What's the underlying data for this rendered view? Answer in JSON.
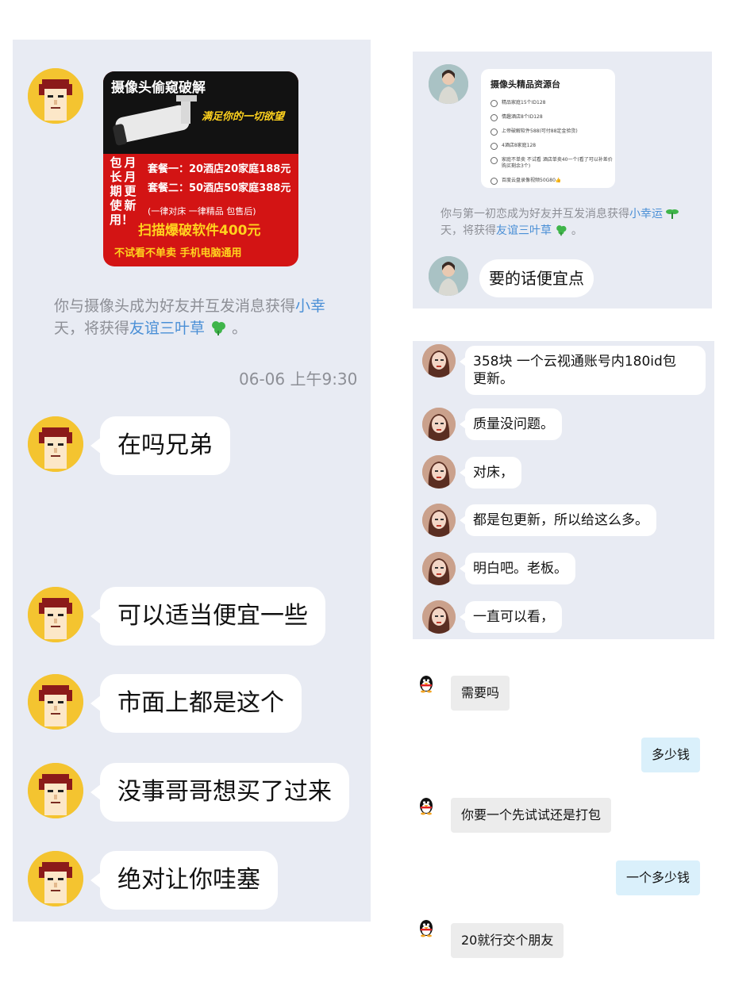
{
  "left_chat": {
    "ad": {
      "title": "摄像头偷窥破解",
      "slogan": "满足你的一切欲望",
      "vertical_col1": "包长期使用！",
      "vertical_col2": "月月更新",
      "package_1": "套餐一：20酒店20家庭188元",
      "package_2": "套餐二：50酒店50家庭388元",
      "note": "(一律对床 一律精品   包售后)",
      "software": "扫描爆破软件400元",
      "footer": "不试看不单卖 手机电脑通用"
    },
    "system_line1_prefix": "你与摄像头成为好友并互发消息获得",
    "system_line1_link": "小幸",
    "system_line2_prefix": "天，将获得",
    "system_line2_link": "友谊三叶草",
    "system_line2_suffix": "。",
    "timestamp": "06-06 上午9:30",
    "messages": [
      "在吗兄弟",
      "可以适当便宜一些",
      "市面上都是这个",
      "没事哥哥想买了过来",
      "绝对让你哇塞"
    ]
  },
  "right_top": {
    "card_title": "摄像头精品资源台",
    "options": [
      "精品家庭15个ID128",
      "情趣酒店8个ID128",
      "上帝破解软件588(可付88定金验货)",
      "4酒店8家庭128",
      "家庭不单卖  不试看  酒店单卖40一个(看了可以补差价购买剩余3个)",
      "百度云盘录像视频50G80👍"
    ],
    "system_line1_prefix": "你与第一初恋成为好友并互发消息获得",
    "system_line1_link": "小幸运",
    "system_line2_prefix": "天，将获得",
    "system_line2_link": "友谊三叶草",
    "system_line2_suffix": "。",
    "message": "要的话便宜点"
  },
  "right_mid": {
    "messages": [
      {
        "line1": "358块    一个云视通账号内180id包",
        "line2": "更新。"
      },
      {
        "line1": "质量没问题。"
      },
      {
        "line1": "对床，"
      },
      {
        "line1": "都是包更新，所以给这么多。"
      },
      {
        "line1": "明白吧。老板。"
      },
      {
        "line1": "一直可以看，"
      }
    ]
  },
  "right_bottom": {
    "messages": [
      {
        "side": "left",
        "text": "需要吗"
      },
      {
        "side": "right",
        "text": "多少钱"
      },
      {
        "side": "left",
        "text": "你要一个先试试还是打包"
      },
      {
        "side": "right",
        "text": "一个多少钱"
      },
      {
        "side": "left",
        "text": "20就行交个朋友"
      }
    ]
  },
  "colors": {
    "chat_bg": "#e8ebf3",
    "link": "#4a8fd6",
    "system_text": "#8d8f96",
    "blue_bubble": "#daf0fb",
    "gray_bubble": "#ececec",
    "ad_red": "#d31414",
    "ad_yellow": "#ffd21e"
  }
}
